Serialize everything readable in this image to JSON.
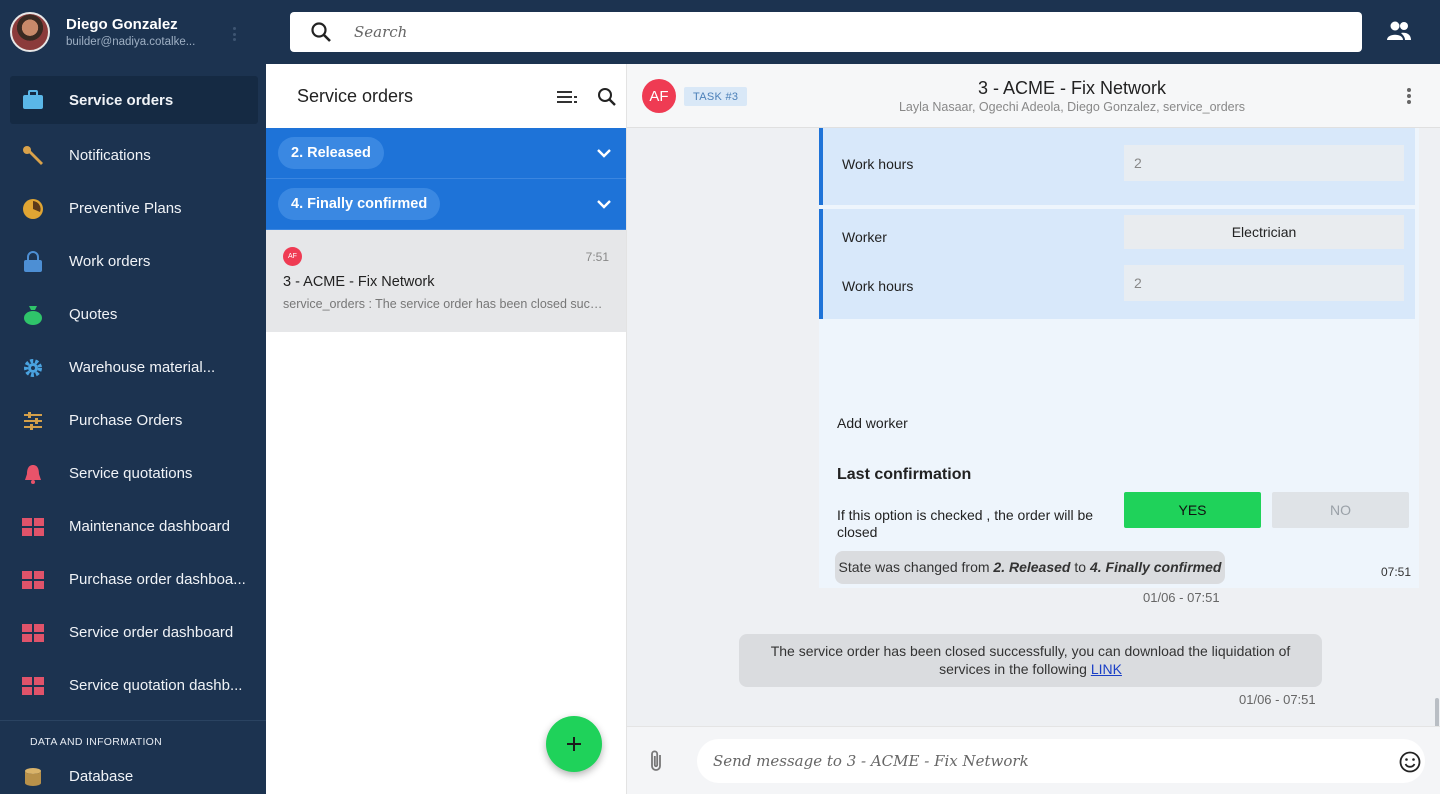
{
  "user": {
    "name": "Diego Gonzalez",
    "email": "builder@nadiya.cotalke..."
  },
  "search": {
    "placeholder": "Search"
  },
  "sidebar": {
    "items": [
      {
        "label": "Service orders",
        "icon": "briefcase-icon",
        "color": "#5ab7e8",
        "active": true
      },
      {
        "label": "Notifications",
        "icon": "wrench-icon",
        "color": "#d9a24a"
      },
      {
        "label": "Preventive Plans",
        "icon": "pie-icon",
        "color": "#e0a533"
      },
      {
        "label": "Work orders",
        "icon": "lock-icon",
        "color": "#4d8fd4"
      },
      {
        "label": "Quotes",
        "icon": "money-bag-icon",
        "color": "#2fc46a"
      },
      {
        "label": "Warehouse material...",
        "icon": "gear-icon",
        "color": "#4aa3e0"
      },
      {
        "label": "Purchase Orders",
        "icon": "sliders-icon",
        "color": "#d4a04a"
      },
      {
        "label": "Service quotations",
        "icon": "bell-icon",
        "color": "#e8536a"
      },
      {
        "label": "Maintenance dashboard",
        "icon": "dashboard-icon",
        "color": "#e0536a"
      },
      {
        "label": "Purchase order dashboa...",
        "icon": "dashboard-icon",
        "color": "#e0536a"
      },
      {
        "label": "Service order dashboard",
        "icon": "dashboard-icon",
        "color": "#e0536a"
      },
      {
        "label": "Service quotation dashb...",
        "icon": "dashboard-icon",
        "color": "#e0536a"
      }
    ],
    "section_label": "DATA AND INFORMATION",
    "section_items": [
      {
        "label": "Database",
        "icon": "database-icon",
        "color": "#d9b36a"
      }
    ]
  },
  "list": {
    "title": "Service orders",
    "groups": [
      {
        "label": "2. Released"
      },
      {
        "label": "4. Finally confirmed"
      }
    ],
    "conversation": {
      "avatar": "AF",
      "time": "7:51",
      "title": "3 - ACME - Fix Network",
      "preview": "service_orders : The service order has been closed successfully, you can download the liquidation of services"
    }
  },
  "chat": {
    "avatar": "AF",
    "badge": "TASK #3",
    "title": "3 - ACME - Fix Network",
    "members": "Layla Nasaar, Ogechi Adeola, Diego Gonzalez, service_orders",
    "form": {
      "worker_label": "Worker",
      "work_hours_label": "Work hours",
      "block1_hours": "2",
      "block2_worker": "Electrician",
      "block2_hours": "2",
      "add_worker": "Add worker",
      "last_confirmation": "Last confirmation",
      "confirmation_text": "If this option is checked , the order will be closed",
      "yes": "YES",
      "no": "NO",
      "time": "07:51"
    },
    "state_change": {
      "prefix": "State was changed from ",
      "from": "2. Released",
      "middle": " to ",
      "to": "4. Finally confirmed",
      "time": "01/06 - 07:51"
    },
    "closed_message": {
      "text": "The service order has been closed successfully, you can download the liquidation of services in the following ",
      "link": "LINK",
      "time": "01/06 - 07:51"
    },
    "composer_placeholder": "Send message to 3 - ACME - Fix Network"
  }
}
